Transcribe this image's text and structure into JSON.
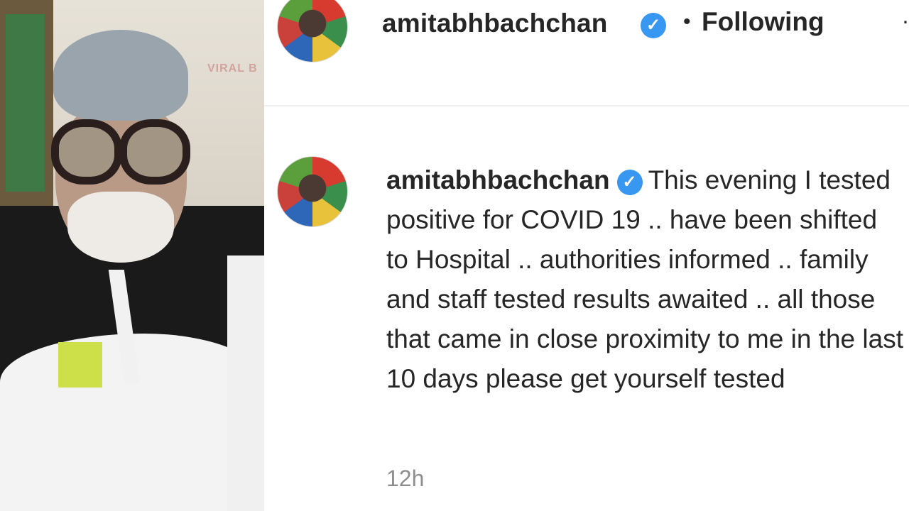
{
  "media": {
    "watermark": "VIRAL B"
  },
  "header": {
    "username": "amitabhbachchan",
    "verified_icon": "verified-badge-icon",
    "separator": "•",
    "follow_label": "Following",
    "more_icon": "more-options-icon"
  },
  "caption": {
    "username": "amitabhbachchan",
    "text": "This evening I tested positive for COVID 19 .. have been shifted to Hospital .. authorities informed .. family and staff tested results awaited .. all those that came in close proximity to me in the last 10 days please get yourself tested",
    "timestamp": "12h"
  },
  "colors": {
    "verified_blue": "#3897f0",
    "text_primary": "#262626",
    "text_secondary": "#8e8e8e",
    "divider": "#efefef"
  }
}
